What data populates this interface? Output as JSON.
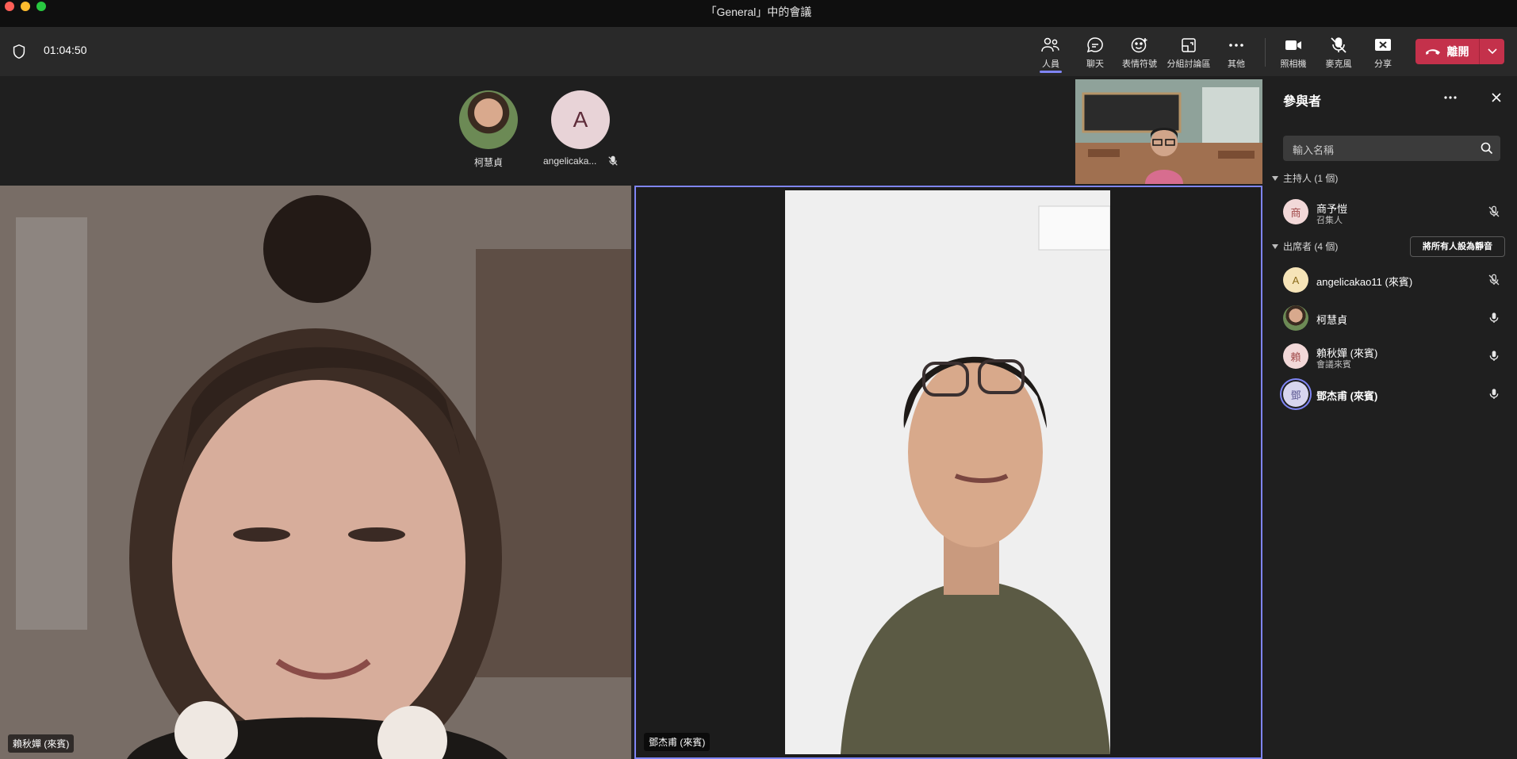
{
  "window": {
    "title": "「General」中的會議"
  },
  "toolbar": {
    "timer": "01:04:50",
    "buttons": [
      {
        "label": "人員",
        "icon": "people-icon"
      },
      {
        "label": "聊天",
        "icon": "chat-icon"
      },
      {
        "label": "表情符號",
        "icon": "emoji-icon"
      },
      {
        "label": "分組討論區",
        "icon": "breakout-rooms-icon"
      },
      {
        "label": "其他",
        "icon": "more-icon"
      },
      {
        "label": "照相機",
        "icon": "camera-icon"
      },
      {
        "label": "麥克風",
        "icon": "mic-off-icon"
      },
      {
        "label": "分享",
        "icon": "share-icon"
      }
    ],
    "leave_label": "離開"
  },
  "stage": {
    "top_participants": [
      {
        "name": "柯慧貞"
      },
      {
        "name": "angelicaka...",
        "initial": "A"
      }
    ],
    "tiles": [
      {
        "name": "賴秋嬋 (來賓)"
      },
      {
        "name": "鄧杰甫 (來賓)"
      }
    ]
  },
  "panel": {
    "title": "參與者",
    "search_placeholder": "輸入名稱",
    "hosts_section": "主持人 (1 個)",
    "attendees_section": "出席者 (4 個)",
    "mute_all_label": "將所有人設為靜音",
    "hosts": [
      {
        "initial": "商",
        "name": "商予愷",
        "role": "召集人",
        "mic": "muted"
      }
    ],
    "attendees": [
      {
        "initial": "A",
        "name": "angelicakao11 (來賓)",
        "role": "",
        "mic": "muted"
      },
      {
        "initial": "",
        "name": "柯慧貞",
        "role": "",
        "mic": "on"
      },
      {
        "initial": "賴",
        "name": "賴秋嬋 (來賓)",
        "role": "會議來賓",
        "mic": "on"
      },
      {
        "initial": "鄧",
        "name": "鄧杰甫 (來賓)",
        "role": "",
        "mic": "on"
      }
    ]
  },
  "colors": {
    "accent": "#7f85f5",
    "leave": "#c4314b",
    "toolbar_bg": "#292929",
    "stage_bg": "#1f1f1f"
  }
}
